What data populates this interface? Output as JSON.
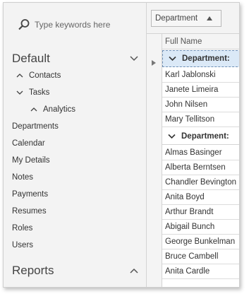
{
  "search": {
    "placeholder": "Type keywords here"
  },
  "nav": {
    "groups": [
      {
        "label": "Default",
        "expanded": true
      },
      {
        "label": "Reports",
        "expanded": false
      }
    ],
    "items": [
      {
        "label": "Contacts"
      },
      {
        "label": "Tasks"
      },
      {
        "label": "Analytics"
      },
      {
        "label": "Departments"
      },
      {
        "label": "Calendar"
      },
      {
        "label": "My Details"
      },
      {
        "label": "Notes"
      },
      {
        "label": "Payments"
      },
      {
        "label": "Resumes"
      },
      {
        "label": "Roles"
      },
      {
        "label": "Users"
      }
    ]
  },
  "grid": {
    "group_by_label": "Department",
    "column_header": "Full Name",
    "group_rows": [
      {
        "label": "Department:"
      },
      {
        "label": "Department:"
      }
    ],
    "rows": [
      "Karl Jablonski",
      "Janete Limeira",
      "John Nilsen",
      "Mary Tellitson",
      "Almas Basinger",
      "Alberta Berntsen",
      "Chandler Bevington",
      "Anita Boyd",
      "Arthur Brandt",
      "Abigail Bunch",
      "George Bunkelman",
      "Bruce Cambell",
      "Anita Cardle"
    ]
  },
  "colors": {
    "focus_row": "#dbe9f7",
    "pane_bg": "#f3f3f3",
    "border": "#d4d4d4"
  }
}
